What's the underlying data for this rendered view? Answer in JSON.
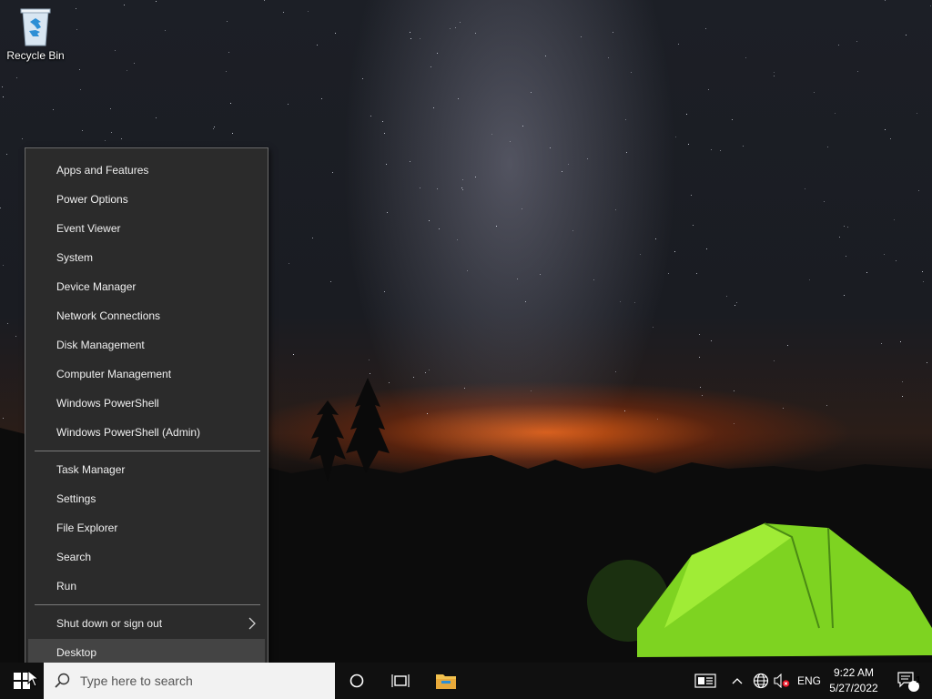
{
  "desktop": {
    "icons": [
      {
        "label": "Recycle Bin",
        "icon": "recycle-bin-icon"
      }
    ]
  },
  "winx_menu": {
    "groups": [
      [
        "Apps and Features",
        "Power Options",
        "Event Viewer",
        "System",
        "Device Manager",
        "Network Connections",
        "Disk Management",
        "Computer Management",
        "Windows PowerShell",
        "Windows PowerShell (Admin)"
      ],
      [
        "Task Manager",
        "Settings",
        "File Explorer",
        "Search",
        "Run"
      ],
      [
        "Shut down or sign out",
        "Desktop"
      ]
    ],
    "submenu_item": "Shut down or sign out",
    "highlighted_item": "Desktop"
  },
  "taskbar": {
    "start_icon": "windows-logo-icon",
    "search": {
      "placeholder": "Type here to search",
      "icon": "search-icon"
    },
    "buttons": [
      "cortana-icon",
      "task-view-icon",
      "file-explorer-icon"
    ],
    "tray": {
      "icons": [
        "news-and-interests-icon",
        "show-hidden-icons-chevron",
        "network-globe-icon",
        "volume-muted-icon"
      ],
      "language": "ENG",
      "time": "9:22 AM",
      "date": "5/27/2022",
      "notification_count": "1"
    }
  },
  "colors": {
    "menu_bg": "#2b2b2b",
    "menu_highlight": "#444444",
    "taskbar_bg": "#101010",
    "tent": "#8ee82a",
    "horizon_glow": "#e0601a"
  }
}
